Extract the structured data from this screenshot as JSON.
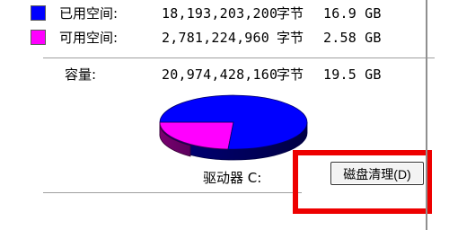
{
  "rows": [
    {
      "label": "已用空间:",
      "bytes": "18,193,203,200",
      "unit": "字节",
      "size": "16.9 GB",
      "color": "#0000ff"
    },
    {
      "label": "可用空间:",
      "bytes": "2,781,224,960",
      "unit": "字节",
      "size": "2.58 GB",
      "color": "#ff00ff"
    }
  ],
  "capacity": {
    "label": "容量:",
    "bytes": "20,974,428,160",
    "unit": "字节",
    "size": "19.5 GB"
  },
  "drive_label": "驱动器 C:",
  "cleanup_button": "磁盘清理(D)",
  "colors": {
    "used": "#0000ff",
    "free": "#ff00ff",
    "highlight": "#ee0000"
  },
  "pie": {
    "used_fraction": 0.8674,
    "free_fraction": 0.1326
  }
}
